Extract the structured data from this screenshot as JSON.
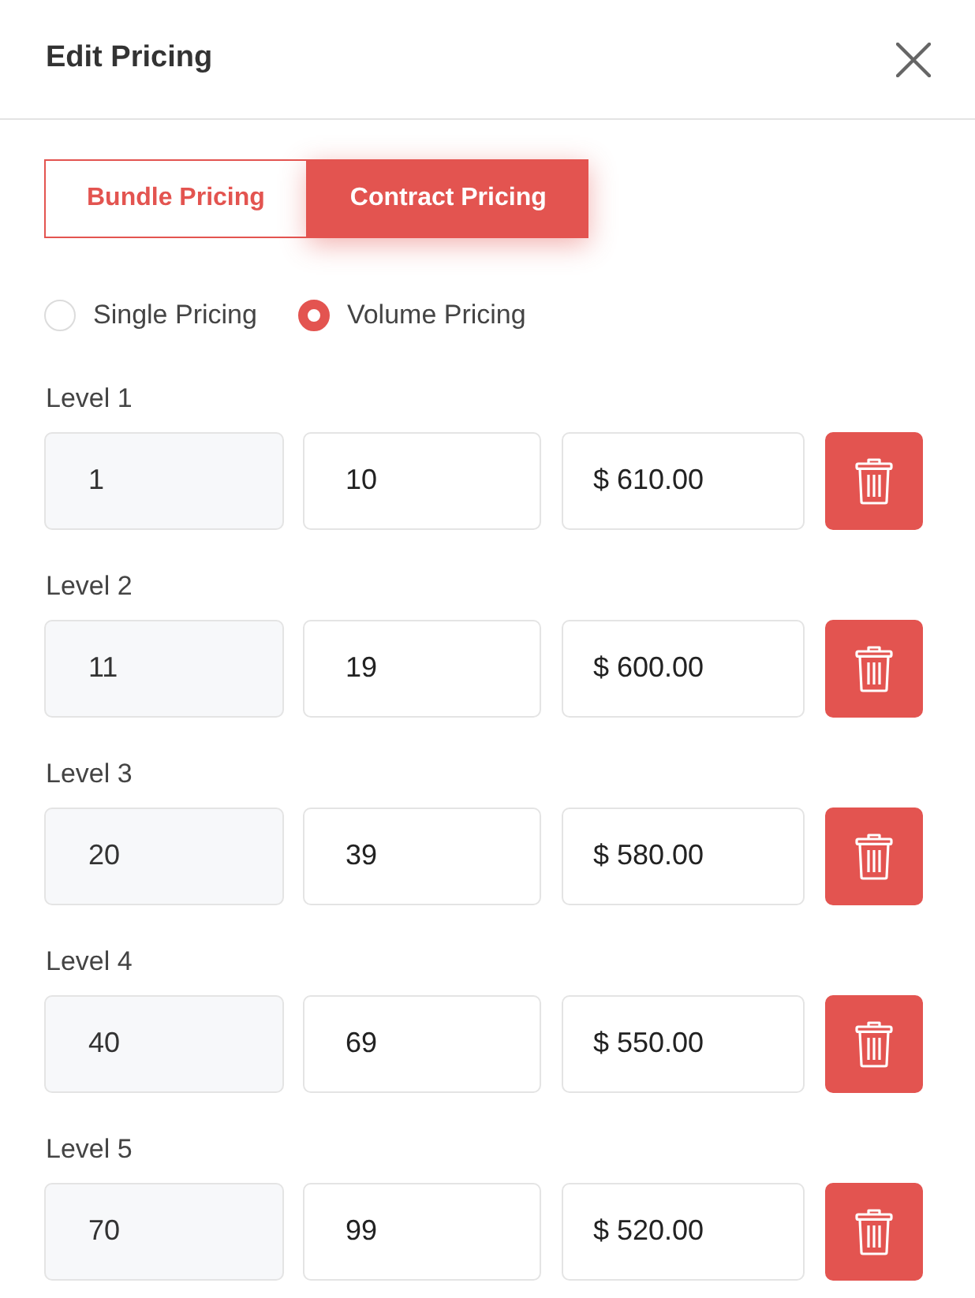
{
  "dialog": {
    "title": "Edit Pricing"
  },
  "tabs": [
    {
      "label": "Bundle Pricing",
      "selected": false
    },
    {
      "label": "Contract Pricing",
      "selected": true
    }
  ],
  "pricing_type": [
    {
      "label": "Single Pricing",
      "selected": false
    },
    {
      "label": "Volume Pricing",
      "selected": true
    }
  ],
  "levels": [
    {
      "label": "Level 1",
      "min": {
        "value": "1",
        "disabled": true
      },
      "max": "10",
      "price": "$ 610.00"
    },
    {
      "label": "Level 2",
      "min": {
        "value": "11",
        "disabled": true
      },
      "max": "19",
      "price": "$ 600.00"
    },
    {
      "label": "Level 3",
      "min": {
        "value": "20",
        "disabled": true
      },
      "max": "39",
      "price": "$ 580.00"
    },
    {
      "label": "Level 4",
      "min": {
        "value": "40",
        "disabled": true
      },
      "max": "69",
      "price": "$ 550.00"
    },
    {
      "label": "Level 5",
      "min": {
        "value": "70",
        "disabled": true
      },
      "max": "99",
      "price": "$ 520.00"
    }
  ]
}
